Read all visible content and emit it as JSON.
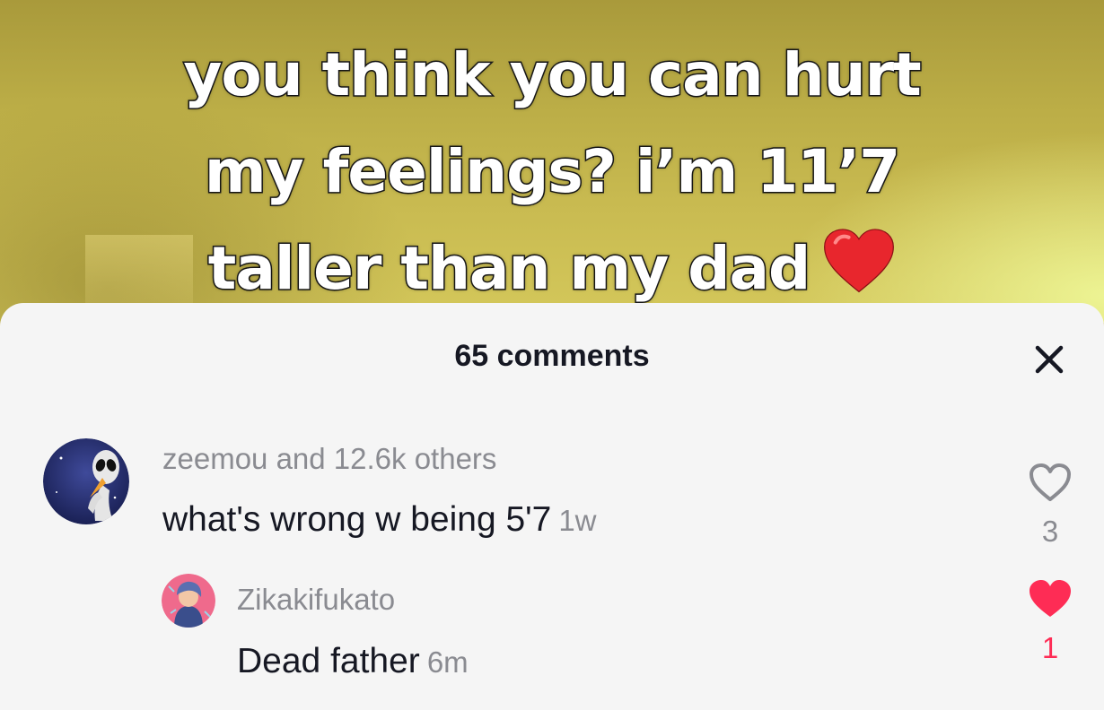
{
  "video": {
    "caption_lines": [
      "you think you can hurt",
      "my feelings? i’m 11’7",
      "taller than my dad"
    ],
    "caption_emoji": "red-heart-emoji"
  },
  "comments_sheet": {
    "title": "65 comments",
    "close_icon": "close-icon",
    "comments": [
      {
        "username": "zeemou and 12.6k others",
        "text": "what's wrong w being 5'7",
        "time": "1w",
        "likes": "3",
        "liked": false,
        "avatar_icon": "alien-avatar"
      },
      {
        "username": "Zikakifukato",
        "text": "Dead father",
        "time": "6m",
        "likes": "1",
        "liked": true,
        "avatar_icon": "anime-avatar"
      }
    ]
  },
  "colors": {
    "like_active": "#fe2c55",
    "secondary_text": "#8a8b91",
    "primary_text": "#161823",
    "sheet_bg": "#f5f5f5"
  }
}
